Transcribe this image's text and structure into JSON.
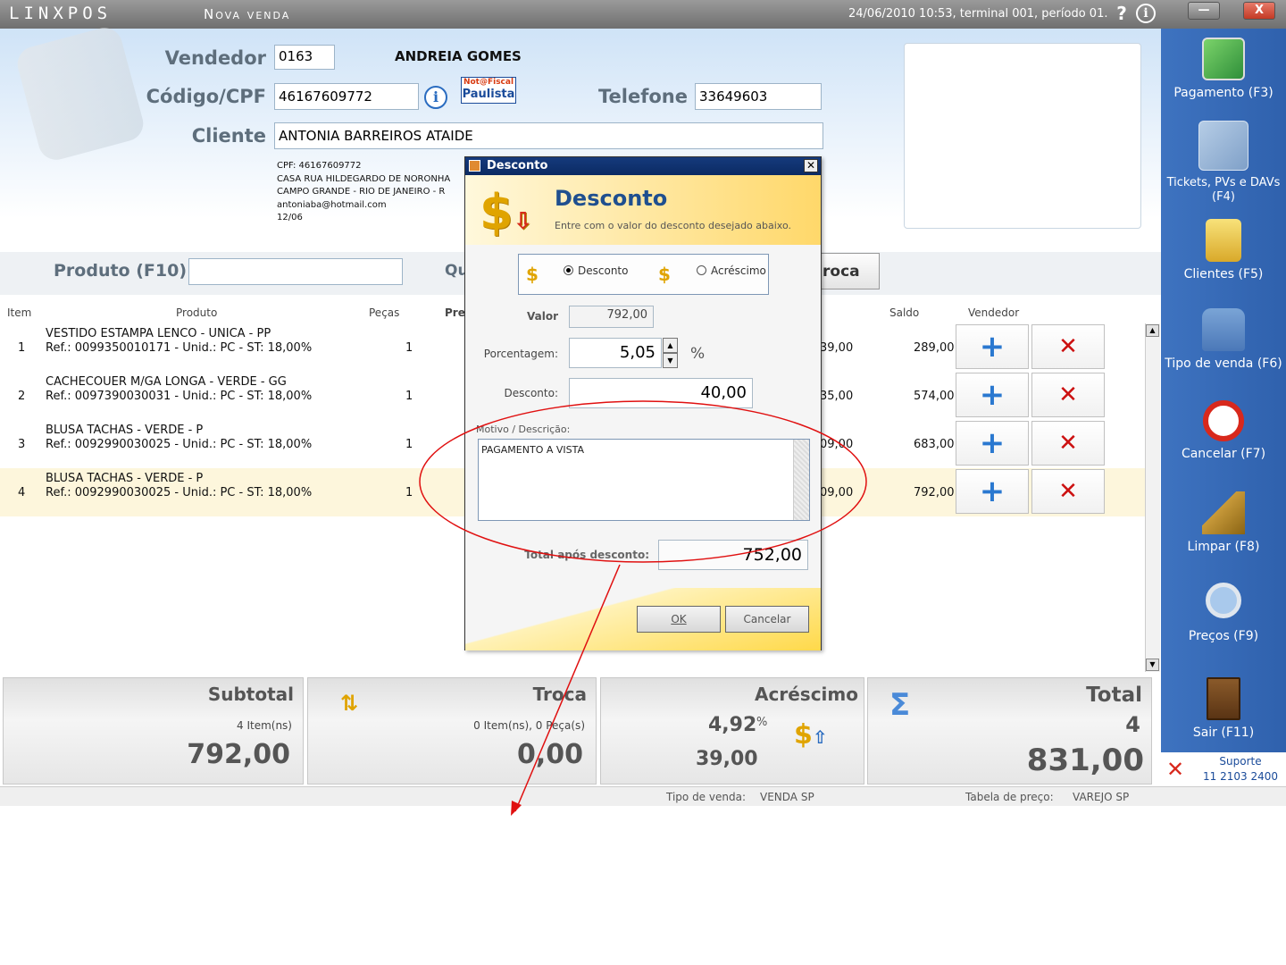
{
  "titlebar": {
    "brand": "LINXPOS",
    "title": "Nova venda",
    "status": "24/06/2010 10:53, terminal 001, período 01.",
    "help": "?",
    "info": "i",
    "minimize": "—",
    "close": "X"
  },
  "header": {
    "vendedor_label": "Vendedor",
    "vendedor_code": "0163",
    "vendedor_name": "ANDREIA GOMES",
    "cpf_label": "Código/CPF",
    "cpf_value": "46167609772",
    "notafiscal_top": "Not@Fiscal",
    "notafiscal_bottom": "Paulista",
    "telefone_label": "Telefone",
    "telefone_value": "33649603",
    "cliente_label": "Cliente",
    "cliente_value": "ANTONIA BARREIROS ATAIDE",
    "info_lines": [
      "CPF: 46167609772",
      "CASA RUA HILDEGARDO DE NORONHA",
      "CAMPO GRANDE - RIO DE JANEIRO - R",
      "antoniaba@hotmail.com",
      "12/06"
    ]
  },
  "product_bar": {
    "label": "Produto (F10)",
    "qty_label_partial": "Qu",
    "troca_partial": "roca"
  },
  "table": {
    "headers": {
      "item": "Item",
      "produto": "Produto",
      "pecas": "Peças",
      "preco_partial": "Pre",
      "saldo": "Saldo",
      "vendedor": "Vendedor"
    },
    "rows": [
      {
        "item": "1",
        "name": "VESTIDO ESTAMPA LENCO - UNICA - PP",
        "ref": "Ref.: 0099350010171 - Unid.: PC - ST: 18,00%",
        "pecas": "1",
        "total_partial": "39,00",
        "saldo": "289,00"
      },
      {
        "item": "2",
        "name": "CACHECOUER M/GA LONGA - VERDE - GG",
        "ref": "Ref.: 0097390030031 - Unid.: PC - ST: 18,00%",
        "pecas": "1",
        "total_partial": "35,00",
        "saldo": "574,00"
      },
      {
        "item": "3",
        "name": "BLUSA TACHAS - VERDE - P",
        "ref": "Ref.: 0092990030025 - Unid.: PC - ST: 18,00%",
        "pecas": "1",
        "total_partial": "09,00",
        "saldo": "683,00"
      },
      {
        "item": "4",
        "name": "BLUSA TACHAS - VERDE - P",
        "ref": "Ref.: 0092990030025 - Unid.: PC - ST: 18,00%",
        "pecas": "1",
        "total_partial": "09,00",
        "saldo": "792,00"
      }
    ],
    "plus": "+",
    "remove": "✕"
  },
  "sidebar": [
    {
      "label": "Pagamento (F3)",
      "icon": "payment-icon"
    },
    {
      "label": "Tickets, PVs e DAVs (F4)",
      "icon": "tickets-icon"
    },
    {
      "label": "Clientes (F5)",
      "icon": "clients-folder-icon"
    },
    {
      "label": "Tipo de venda (F6)",
      "icon": "shopping-bag-icon"
    },
    {
      "label": "Cancelar (F7)",
      "icon": "cancel-icon"
    },
    {
      "label": "Limpar (F8)",
      "icon": "broom-icon"
    },
    {
      "label": "Preços (F9)",
      "icon": "magnifier-icon"
    },
    {
      "label": "Sair (F11)",
      "icon": "door-exit-icon"
    }
  ],
  "support": {
    "label": "Suporte",
    "phone": "11 2103 2400"
  },
  "totals": {
    "subtotal": {
      "title": "Subtotal",
      "items": "4 Item(ns)",
      "value": "792,00"
    },
    "troca": {
      "title": "Troca",
      "items": "0 Item(ns), 0 Peça(s)",
      "value": "0,00"
    },
    "acrescimo": {
      "title": "Acréscimo",
      "percent": "4,92",
      "percent_sign": "%",
      "value": "39,00"
    },
    "total": {
      "title": "Total",
      "count": "4",
      "value": "831,00"
    }
  },
  "footer": {
    "tipo_label": "Tipo de venda:",
    "tipo_value": "VENDA SP",
    "tabela_label": "Tabela de preço:",
    "tabela_value": "VAREJO SP"
  },
  "dialog": {
    "window_title": "Desconto",
    "close": "✕",
    "heading": "Desconto",
    "subheading": "Entre com o valor do desconto desejado abaixo.",
    "option_desconto": "Desconto",
    "option_acrescimo": "Acréscimo",
    "valor_label": "Valor",
    "valor_value": "792,00",
    "porcentagem_label": "Porcentagem:",
    "porcentagem_value": "5,05",
    "percent_sign": "%",
    "desconto_label": "Desconto:",
    "desconto_value": "40,00",
    "motivo_label": "Motivo / Descrição:",
    "motivo_value": "PAGAMENTO A VISTA",
    "total_label": "Total após desconto:",
    "total_value": "752,00",
    "ok": "OK",
    "cancel": "Cancelar"
  },
  "colors": {
    "sidebar": "#3568b4",
    "title_bar": "#7f7f7f",
    "dialog_title": "#0f3170",
    "annotation_red": "#e01010",
    "plus_blue": "#2a78d0",
    "remove_red": "#cc1111"
  }
}
